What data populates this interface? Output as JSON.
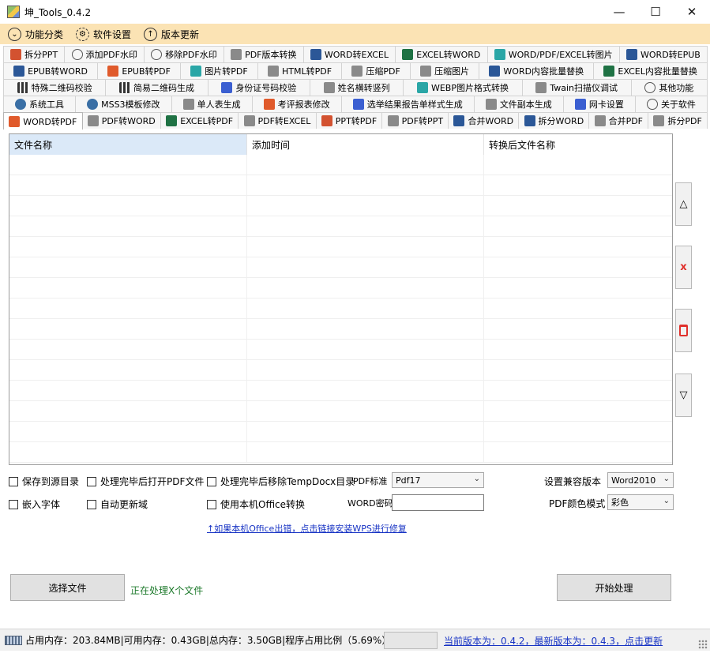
{
  "window": {
    "title": "坤_Tools_0.4.2",
    "minimize": "—",
    "maximize": "☐",
    "close": "✕"
  },
  "menu": [
    {
      "label": "功能分类",
      "icon": "shield-icon"
    },
    {
      "label": "软件设置",
      "icon": "gear-icon"
    },
    {
      "label": "版本更新",
      "icon": "arrow-up-circle-icon"
    }
  ],
  "tab_rows": [
    [
      {
        "label": "拆分PPT",
        "icon": "ppt"
      },
      {
        "label": "添加PDF水印",
        "icon": "circle"
      },
      {
        "label": "移除PDF水印",
        "icon": "circle"
      },
      {
        "label": "PDF版本转换",
        "icon": "gray"
      },
      {
        "label": "WORD转EXCEL",
        "icon": "word"
      },
      {
        "label": "EXCEL转WORD",
        "icon": "excel"
      },
      {
        "label": "WORD/PDF/EXCEL转图片",
        "icon": "img"
      },
      {
        "label": "WORD转EPUB",
        "icon": "word"
      }
    ],
    [
      {
        "label": "EPUB转WORD",
        "icon": "word"
      },
      {
        "label": "EPUB转PDF",
        "icon": "pdf"
      },
      {
        "label": "图片转PDF",
        "icon": "img"
      },
      {
        "label": "HTML转PDF",
        "icon": "gray"
      },
      {
        "label": "压缩PDF",
        "icon": "gray"
      },
      {
        "label": "压缩图片",
        "icon": "gray"
      },
      {
        "label": "WORD内容批量替换",
        "icon": "word"
      },
      {
        "label": "EXCEL内容批量替换",
        "icon": "excel"
      }
    ],
    [
      {
        "label": "特殊二维码校验",
        "icon": "qr"
      },
      {
        "label": "简易二维码生成",
        "icon": "qr"
      },
      {
        "label": "身份证号码校验",
        "icon": "blue"
      },
      {
        "label": "姓名横转竖列",
        "icon": "gray"
      },
      {
        "label": "WEBP图片格式转换",
        "icon": "img"
      },
      {
        "label": "Twain扫描仪调试",
        "icon": "gray"
      },
      {
        "label": "其他功能",
        "icon": "circle"
      }
    ],
    [
      {
        "label": "系统工具",
        "icon": "gear"
      },
      {
        "label": "MSS3模板修改",
        "icon": "gear"
      },
      {
        "label": "单人表生成",
        "icon": "gray"
      },
      {
        "label": "考评报表修改",
        "icon": "pdf"
      },
      {
        "label": "选举结果报告单样式生成",
        "icon": "blue"
      },
      {
        "label": "文件副本生成",
        "icon": "gray"
      },
      {
        "label": "网卡设置",
        "icon": "blue"
      },
      {
        "label": "关于软件",
        "icon": "circle"
      }
    ],
    [
      {
        "label": "WORD转PDF",
        "icon": "pdf",
        "active": true
      },
      {
        "label": "PDF转WORD",
        "icon": "gray"
      },
      {
        "label": "EXCEL转PDF",
        "icon": "excel"
      },
      {
        "label": "PDF转EXCEL",
        "icon": "gray"
      },
      {
        "label": "PPT转PDF",
        "icon": "ppt"
      },
      {
        "label": "PDF转PPT",
        "icon": "gray"
      },
      {
        "label": "合并WORD",
        "icon": "word"
      },
      {
        "label": "拆分WORD",
        "icon": "word"
      },
      {
        "label": "合并PDF",
        "icon": "gray"
      },
      {
        "label": "拆分PDF",
        "icon": "gray"
      }
    ]
  ],
  "table": {
    "headers": [
      "文件名称",
      "添加时间",
      "转换后文件名称"
    ],
    "empty_rows": 15
  },
  "side_buttons": {
    "up": "△",
    "delete": "x",
    "down": "▽"
  },
  "options": {
    "save_to_source": "保存到源目录",
    "open_after": "处理完毕后打开PDF文件",
    "remove_temp": "处理完毕后移除TempDocx目录",
    "embed_fonts": "嵌入字体",
    "auto_update_fields": "自动更新域",
    "use_local_office": "使用本机Office转换",
    "pdf_standard_label": "PDF标准",
    "pdf_standard_value": "Pdf17",
    "word_password_label": "WORD密码",
    "word_password_value": "",
    "compat_version_label": "设置兼容版本",
    "compat_version_value": "Word2010",
    "pdf_color_label": "PDF颜色模式",
    "pdf_color_value": "彩色"
  },
  "repair_link": "↑如果本机Office出错，点击链接安装WPS进行修复",
  "select_file_button": "选择文件",
  "processing_note": "正在处理X个文件",
  "start_button": "开始处理",
  "status": {
    "memory_text": "占用内存：203.84MB|可用内存：0.43GB|总内存：3.50GB|程序占用比例（5.69%）",
    "progress": 0,
    "version_text": "当前版本为：0.4.2，最新版本为：0.4.3，点击更新"
  }
}
